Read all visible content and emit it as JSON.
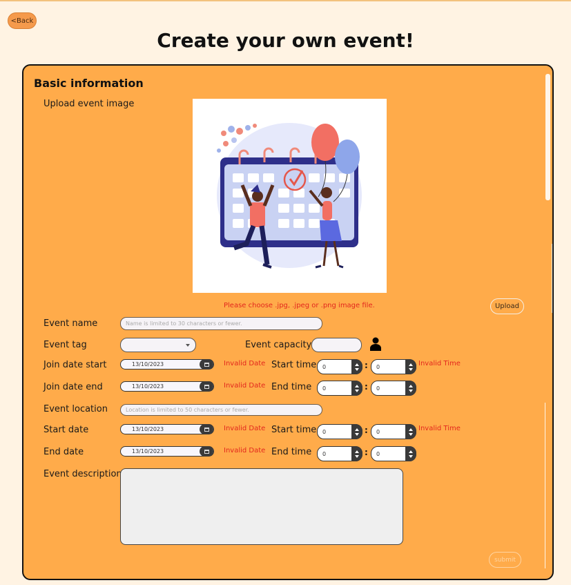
{
  "header": {
    "back_label": "<Back",
    "title": "Create your own event!"
  },
  "form": {
    "section_title": "Basic information",
    "upload_image_label": "Upload event image",
    "image_hint": "Please choose .jpg, .jpeg or .png image file.",
    "upload_button": "Upload",
    "event_name_label": "Event name",
    "event_name_placeholder": "Name is limited to 30 characters or fewer.",
    "event_tag_label": "Event tag",
    "event_tag_value": "",
    "event_capacity_label": "Event capacity",
    "event_capacity_value": "",
    "join_start_label": "Join date start",
    "join_end_label": "Join date end",
    "location_label": "Event location",
    "location_placeholder": "Location is limited to 50 characters or fewer.",
    "start_date_label": "Start date",
    "end_date_label": "End date",
    "description_label": "Event description",
    "start_time_label": "Start time",
    "end_time_label": "End time",
    "date_value": "13/10/2023",
    "time_value": "0",
    "invalid_date": "Invalid Date",
    "invalid_time": "Invalid Time",
    "submit_label": "submit"
  },
  "icons": {
    "capacity": "person-icon",
    "calendar": "calendar-icon"
  },
  "colors": {
    "panel": "#ffab4a",
    "page_bg": "#fff3e3",
    "error": "#e3261d",
    "back_button": "#f59a4c"
  }
}
